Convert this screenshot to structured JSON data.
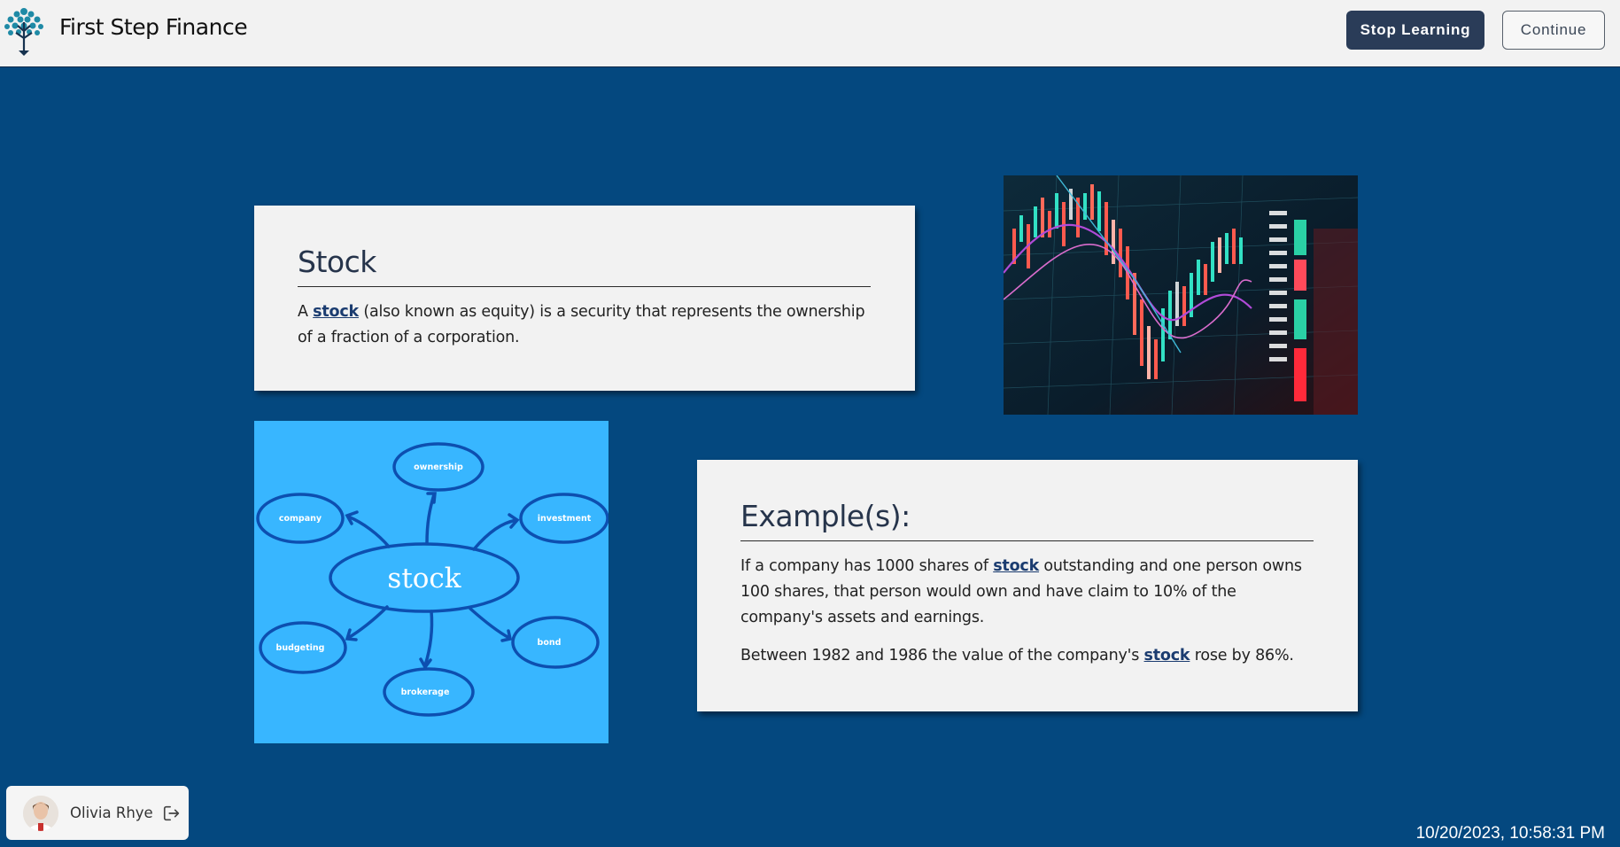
{
  "header": {
    "brand": "First Step Finance",
    "logo_icon": "tree-icon",
    "stop_label": "Stop Learning",
    "continue_label": "Continue"
  },
  "definition": {
    "title": "Stock",
    "text_before": "A ",
    "term": "stock",
    "text_after": " (also known as equity) is a security that represents the ownership of a fraction of a corporation."
  },
  "examples": {
    "title": "Example(s):",
    "ex1_before": "If a company has 1000 shares of ",
    "ex1_term": "stock",
    "ex1_after": " outstanding and one person owns 100 shares, that person would own and have claim to 10% of the company's assets and earnings.",
    "ex2_before": "Between 1982 and 1986 the value of the company's ",
    "ex2_term": "stock",
    "ex2_after": " rose by 86%."
  },
  "mindmap": {
    "center": "stock",
    "nodes": [
      "ownership",
      "investment",
      "bond",
      "brokerage",
      "budgeting",
      "company"
    ]
  },
  "user": {
    "name": "Olivia Rhye",
    "logout_icon": "logout-icon"
  },
  "timestamp": "10/20/2023, 10:58:31 PM",
  "colors": {
    "background": "#04487f",
    "header_bg": "#f2f2f2",
    "primary_button": "#2a3c58",
    "card_bg": "#f2f2f2",
    "link": "#1b3c70",
    "mindmap_bg": "#38b6ff"
  }
}
